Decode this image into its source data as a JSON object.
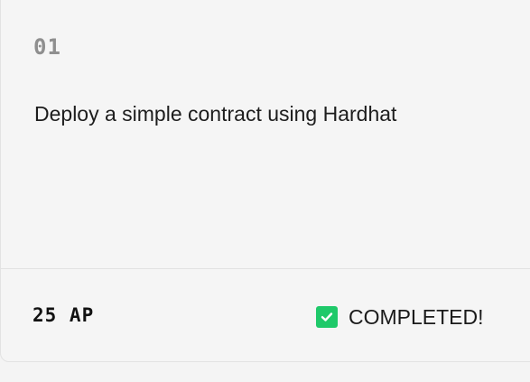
{
  "task": {
    "number": "01",
    "title": "Deploy a simple contract using Hardhat",
    "reward": "25 AP",
    "status": "COMPLETED!",
    "status_icon": "check-icon",
    "status_color": "#1fc96a"
  }
}
